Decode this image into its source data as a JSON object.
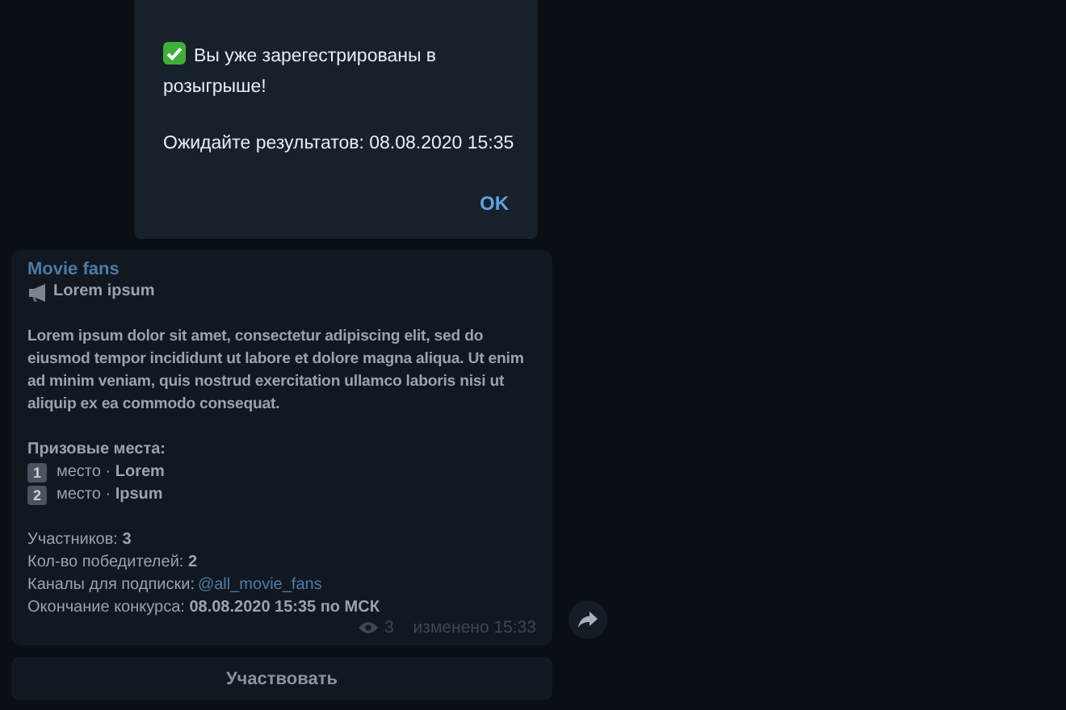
{
  "dialog": {
    "message": "Вы уже зарегестрированы в розыгрыше!",
    "note": "Ожидайте результатов: 08.08.2020 15:35",
    "button": "OK"
  },
  "post": {
    "author": "Movie fans",
    "title": "Lorem ipsum",
    "body": "Lorem ipsum dolor sit amet, consectetur adipiscing elit, sed do eiusmod tempor incididunt ut labore et dolore magna aliqua. Ut enim ad minim veniam, quis nostrud exercitation ullamco laboris nisi ut aliquip ex ea commodo consequat.",
    "prizes_heading": "Призовые места:",
    "prizes": [
      {
        "rank": "1",
        "text": "место · **Lorem**"
      },
      {
        "rank": "2",
        "text": "место · **Ipsum**"
      }
    ],
    "stats": [
      "Участников: **3**",
      "Кол-во победителей: **2**"
    ],
    "channels_label": "Каналы для подписки:",
    "channel_link": "@all_movie_fans",
    "ending": "Окончание конкурса: **08.08.2020 15:35 по МСК**",
    "views": "3",
    "edited": "изменено 15:33"
  },
  "action_button": "Участвовать"
}
